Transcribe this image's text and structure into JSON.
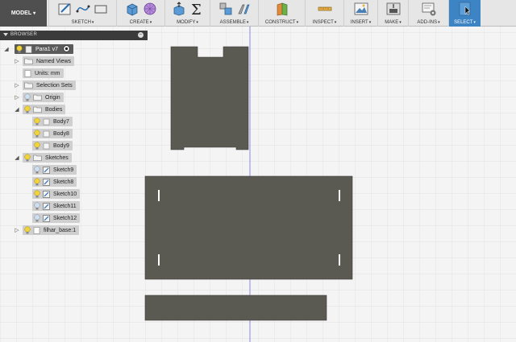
{
  "toolbar": {
    "model_label": "MODEL",
    "groups": [
      {
        "label": "SKETCH"
      },
      {
        "label": "CREATE"
      },
      {
        "label": "MODIFY"
      },
      {
        "label": "ASSEMBLE"
      },
      {
        "label": "CONSTRUCT"
      },
      {
        "label": "INSPECT"
      },
      {
        "label": "INSERT"
      },
      {
        "label": "MAKE"
      },
      {
        "label": "ADD-INS"
      },
      {
        "label": "SELECT"
      }
    ],
    "colors": {
      "select_bg": "#3d84c4",
      "model_bg": "#4f4f4f"
    }
  },
  "browser": {
    "title": "BROWSER",
    "root": "Para1 v7",
    "named_views": "Named Views",
    "units": "Units: mm",
    "selection_sets": "Selection Sets",
    "origin": "Origin",
    "bodies": {
      "label": "Bodies",
      "items": [
        "Body7",
        "Body8",
        "Body9"
      ]
    },
    "sketches": {
      "label": "Sketches",
      "items": [
        "Sketch9",
        "Sketch8",
        "Sketch10",
        "Sketch11",
        "Sketch12"
      ]
    },
    "component": "filhar_base:1"
  },
  "canvas": {
    "background": "#f4f4f4",
    "grid_color": "#dcdcdc",
    "body_color": "#5a5952",
    "axis_color": "#8a8ae6"
  }
}
